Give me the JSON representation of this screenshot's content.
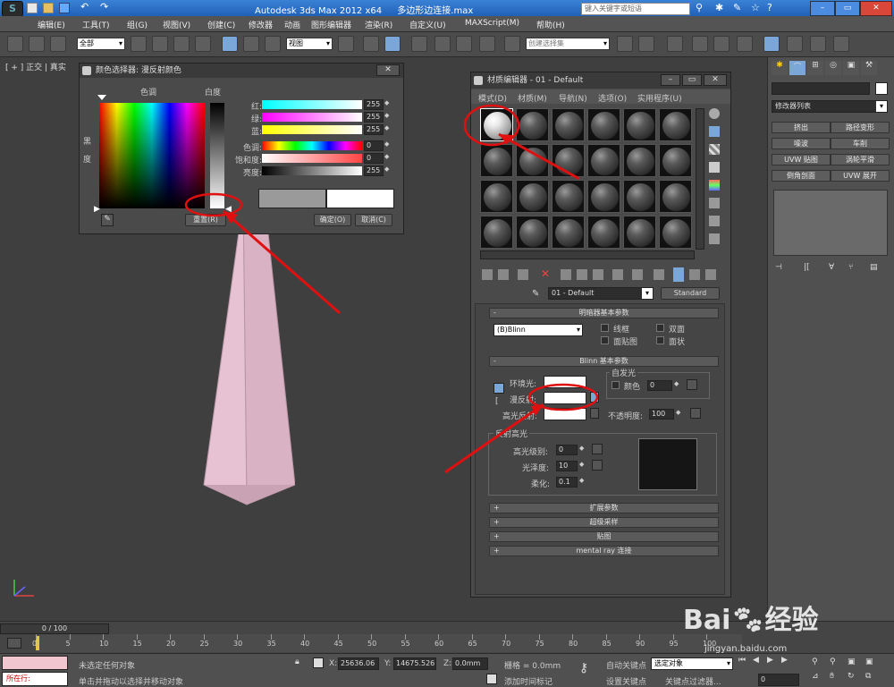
{
  "title_bar": {
    "app_title": "Autodesk 3ds Max  2012 x64",
    "file_name": "多边形边连接.max",
    "search_placeholder": "键入关键字或短语"
  },
  "menu": [
    "编辑(E)",
    "工具(T)",
    "组(G)",
    "视图(V)",
    "创建(C)",
    "修改器",
    "动画",
    "图形编辑器",
    "渲染(R)",
    "自定义(U)",
    "MAXScript(M)",
    "帮助(H)"
  ],
  "toolbar": {
    "selection_filter": "全部",
    "ref_coord": "视图",
    "named_selection": "创建选择集"
  },
  "viewport": {
    "label": "[ + ] 正交 | 真实"
  },
  "color_picker": {
    "title": "颜色选择器: 漫反射颜色",
    "hue_label": "色调",
    "whiteness_label": "白度",
    "blackness_label": "黑度",
    "channels": [
      {
        "label": "红:",
        "value": "255"
      },
      {
        "label": "绿:",
        "value": "255"
      },
      {
        "label": "蓝:",
        "value": "255"
      },
      {
        "label": "色调:",
        "value": "0"
      },
      {
        "label": "饱和度:",
        "value": "0"
      },
      {
        "label": "亮度:",
        "value": "255"
      }
    ],
    "reset_button": "重置(R)",
    "ok_button": "确定(O)",
    "cancel_button": "取消(C)",
    "new_color": "#ffffff",
    "old_color": "#9a9a9a"
  },
  "material_editor": {
    "title": "材质编辑器 - 01 - Default",
    "menu": [
      "模式(D)",
      "材质(M)",
      "导航(N)",
      "选项(O)",
      "实用程序(U)"
    ],
    "material_name": "01 - Default",
    "material_type": "Standard",
    "shader_rollout": "明暗器基本参数",
    "shader_type": "(B)Blinn",
    "checks": [
      "线框",
      "双面",
      "面贴图",
      "面状"
    ],
    "blinn_rollout": "Blinn 基本参数",
    "ambient_label": "环境光:",
    "diffuse_label": "漫反射:",
    "specular_label": "高光反射:",
    "self_illum_label": "自发光",
    "color_check": "颜色",
    "self_illum_value": "0",
    "opacity_label": "不透明度:",
    "opacity_value": "100",
    "specular_group": "反射高光",
    "spec_level_label": "高光级别:",
    "spec_level_value": "0",
    "gloss_label": "光泽度:",
    "gloss_value": "10",
    "soften_label": "柔化:",
    "soften_value": "0.1",
    "rollouts": [
      "扩展参数",
      "超级采样",
      "贴图",
      "mental ray 连接"
    ]
  },
  "right_panel": {
    "modifier_list": "修改器列表",
    "buttons": [
      "挤出",
      "路径变形",
      "噪波",
      "车削",
      "UVW 贴图",
      "涡轮平滑",
      "倒角剖面",
      "UVW 展开"
    ]
  },
  "timeline": {
    "frame_counter": "0 / 100",
    "ticks": [
      "0",
      "5",
      "10",
      "15",
      "20",
      "25",
      "30",
      "35",
      "40",
      "45",
      "50",
      "55",
      "60",
      "65",
      "70",
      "75",
      "80",
      "85",
      "90",
      "95",
      "100"
    ]
  },
  "status": {
    "running": "所在行:",
    "selection_msg": "未选定任何对象",
    "prompt": "单击并拖动以选择并移动对象",
    "x_value": "25636.06",
    "y_value": "14675.526",
    "z_value": "0.0mm",
    "grid": "栅格 = 0.0mm",
    "add_time_tag": "添加时间标记",
    "auto_key": "自动关键点",
    "set_key": "设置关键点",
    "selected_objects": "选定对象",
    "key_filters": "关键点过滤器...",
    "frame_value": "0"
  },
  "watermark": {
    "site": "jingyan.baidu.com"
  }
}
